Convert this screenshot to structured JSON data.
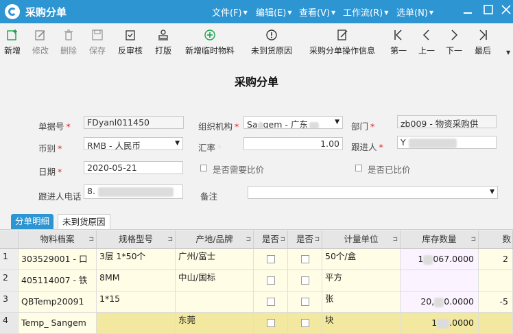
{
  "app": {
    "title": "采购分单"
  },
  "menu": [
    {
      "label": "文件(F)"
    },
    {
      "label": "编辑(E)"
    },
    {
      "label": "查看(V)"
    },
    {
      "label": "工作流(R)"
    },
    {
      "label": "选单(N)"
    }
  ],
  "toolbar": {
    "new": "新增",
    "edit": "修改",
    "delete": "删除",
    "save": "保存",
    "unaudit": "反审核",
    "print": "打版",
    "add_temp": "新增临时物料",
    "not_arrived": "未到货原因",
    "op_info": "采购分单操作信息",
    "first": "第一",
    "prev": "上一",
    "next": "下一",
    "last": "最后"
  },
  "form": {
    "title": "采购分单",
    "doc_no_label": "单据号",
    "doc_no": "FDyanl011450",
    "org_label": "组织机构",
    "org_value_a": "Sa",
    "org_value_b": "gem - 广东",
    "dept_label": "部门",
    "dept_value": "zb009 - 物资采购供",
    "currency_label": "币别",
    "currency_value": "RMB - 人民币",
    "rate_label": "汇率",
    "rate_value": "1.00",
    "follower_label": "跟进人",
    "follower_value": "Y",
    "date_label": "日期",
    "date_value": "2020-05-21",
    "need_compare_label": "是否需要比价",
    "compared_label": "是否已比价",
    "phone_label": "跟进人电话",
    "phone_value": "8.",
    "remark_label": "备注",
    "remark_value": ""
  },
  "tabs": {
    "detail": "分单明细",
    "reason": "未到货原因"
  },
  "grid": {
    "headers": {
      "material": "物料档案",
      "spec": "规格型号",
      "origin": "产地/品牌",
      "yn1": "是否",
      "yn2": "是否",
      "unit": "计量单位",
      "stock": "库存数量",
      "extra": "数"
    },
    "rows": [
      {
        "no": "1",
        "material": "303529001 - 口",
        "spec": "3层 1*50个",
        "origin": "广州/富士",
        "unit": "50个/盒",
        "stock_a": "1",
        "stock_b": "067.0000",
        "extra": "2"
      },
      {
        "no": "2",
        "material": "405114007 - 铁",
        "spec": "8MM",
        "origin": "中山/国标",
        "unit": "平方",
        "stock_a": "",
        "stock_b": "",
        "extra": ""
      },
      {
        "no": "3",
        "material": "QBTemp20091",
        "spec": "1*15",
        "origin": "",
        "unit": "张",
        "stock_a": "20,",
        "stock_b": "0.0000",
        "extra": "-5"
      },
      {
        "no": "4",
        "material": "Temp_ Sangem",
        "spec": "",
        "origin": "东莞",
        "unit": "块",
        "stock_a": "1",
        "stock_b": ".0000",
        "extra": ""
      }
    ]
  }
}
